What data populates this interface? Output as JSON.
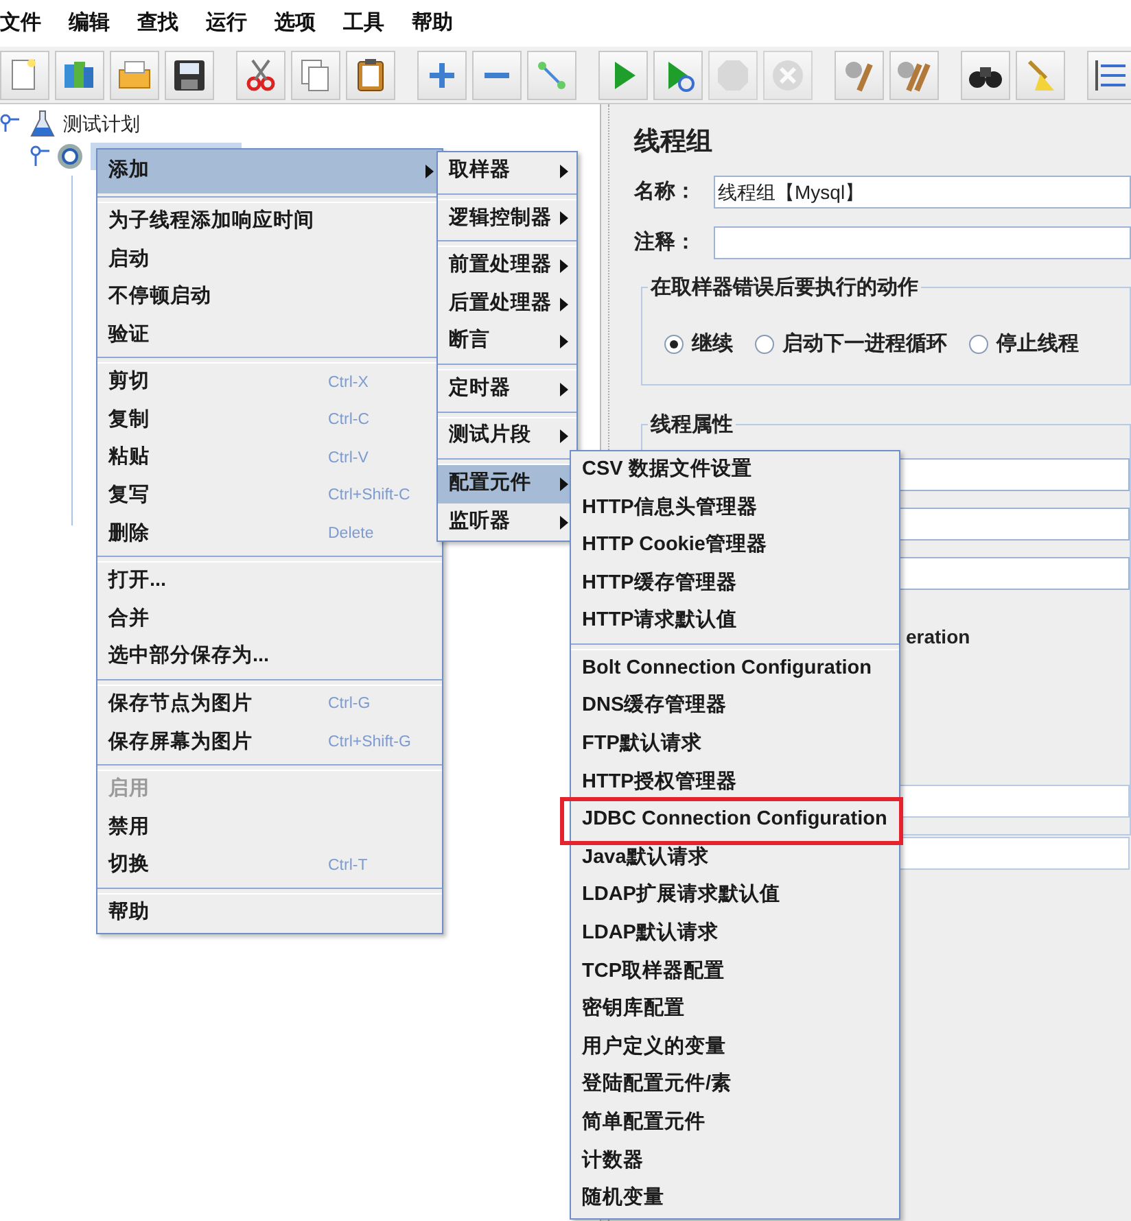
{
  "menu_bar": [
    "文件",
    "编辑",
    "查找",
    "运行",
    "选项",
    "工具",
    "帮助"
  ],
  "toolbar": [
    [
      {
        "disabled": false
      },
      {
        "disabled": false
      },
      {
        "disabled": false
      },
      {
        "disabled": false
      }
    ],
    [
      {
        "disabled": false
      },
      {
        "disabled": false
      },
      {
        "disabled": false
      }
    ],
    [
      {
        "disabled": false
      },
      {
        "disabled": false
      },
      {
        "disabled": false
      }
    ],
    [
      {
        "disabled": false
      },
      {
        "disabled": false
      },
      {
        "disabled": true
      },
      {
        "disabled": true
      }
    ],
    [
      {
        "disabled": false
      },
      {
        "disabled": false
      }
    ],
    [
      {
        "disabled": false
      },
      {
        "disabled": false
      }
    ],
    [
      {
        "disabled": false
      }
    ]
  ],
  "tree": {
    "label": "测试计划",
    "children": [
      {
        "selected": true
      }
    ]
  },
  "context_menu": [
    {
      "kind": "item",
      "label": "添加",
      "submenu": true,
      "selected": true
    },
    {
      "kind": "separator"
    },
    {
      "kind": "item",
      "label": "为子线程添加响应时间"
    },
    {
      "kind": "item",
      "label": "启动"
    },
    {
      "kind": "item",
      "label": "不停顿启动"
    },
    {
      "kind": "item",
      "label": "验证"
    },
    {
      "kind": "separator"
    },
    {
      "kind": "item",
      "label": "剪切",
      "shortcut": "Ctrl-X"
    },
    {
      "kind": "item",
      "label": "复制",
      "shortcut": "Ctrl-C"
    },
    {
      "kind": "item",
      "label": "粘贴",
      "shortcut": "Ctrl-V"
    },
    {
      "kind": "item",
      "label": "复写",
      "shortcut": "Ctrl+Shift-C"
    },
    {
      "kind": "item",
      "label": "删除",
      "shortcut": "Delete"
    },
    {
      "kind": "separator"
    },
    {
      "kind": "item",
      "label": "打开..."
    },
    {
      "kind": "item",
      "label": "合并"
    },
    {
      "kind": "item",
      "label": "选中部分保存为..."
    },
    {
      "kind": "separator"
    },
    {
      "kind": "item",
      "label": "保存节点为图片",
      "shortcut": "Ctrl-G"
    },
    {
      "kind": "item",
      "label": "保存屏幕为图片",
      "shortcut": "Ctrl+Shift-G"
    },
    {
      "kind": "separator"
    },
    {
      "kind": "item",
      "label": "启用",
      "disabled": true
    },
    {
      "kind": "item",
      "label": "禁用"
    },
    {
      "kind": "item",
      "label": "切换",
      "shortcut": "Ctrl-T"
    },
    {
      "kind": "separator"
    },
    {
      "kind": "item",
      "label": "帮助"
    }
  ],
  "add_submenu": [
    {
      "kind": "item",
      "label": "取样器",
      "submenu": true,
      "selected": false
    },
    {
      "kind": "separator"
    },
    {
      "kind": "item",
      "label": "逻辑控制器",
      "submenu": true,
      "selected": false
    },
    {
      "kind": "separator"
    },
    {
      "kind": "item",
      "label": "前置处理器",
      "submenu": true,
      "selected": false
    },
    {
      "kind": "item",
      "label": "后置处理器",
      "submenu": true,
      "selected": false
    },
    {
      "kind": "item",
      "label": "断言",
      "submenu": true,
      "selected": false
    },
    {
      "kind": "separator"
    },
    {
      "kind": "item",
      "label": "定时器",
      "submenu": true,
      "selected": false
    },
    {
      "kind": "separator"
    },
    {
      "kind": "item",
      "label": "测试片段",
      "submenu": true,
      "selected": false
    },
    {
      "kind": "separator"
    },
    {
      "kind": "item",
      "label": "配置元件",
      "submenu": true,
      "selected": true
    },
    {
      "kind": "item",
      "label": "监听器",
      "submenu": true,
      "selected": false
    }
  ],
  "config_submenu": [
    {
      "kind": "item",
      "label": "CSV 数据文件设置"
    },
    {
      "kind": "item",
      "label": "HTTP信息头管理器"
    },
    {
      "kind": "item",
      "label": "HTTP Cookie管理器"
    },
    {
      "kind": "item",
      "label": "HTTP缓存管理器"
    },
    {
      "kind": "item",
      "label": "HTTP请求默认值"
    },
    {
      "kind": "separator"
    },
    {
      "kind": "item",
      "label": "Bolt Connection Configuration"
    },
    {
      "kind": "item",
      "label": "DNS缓存管理器"
    },
    {
      "kind": "item",
      "label": "FTP默认请求"
    },
    {
      "kind": "item",
      "label": "HTTP授权管理器"
    },
    {
      "kind": "item",
      "label": "JDBC Connection Configuration",
      "highlighted": true
    },
    {
      "kind": "item",
      "label": "Java默认请求"
    },
    {
      "kind": "item",
      "label": "LDAP扩展请求默认值"
    },
    {
      "kind": "item",
      "label": "LDAP默认请求"
    },
    {
      "kind": "item",
      "label": "TCP取样器配置"
    },
    {
      "kind": "item",
      "label": "密钥库配置"
    },
    {
      "kind": "item",
      "label": "用户定义的变量"
    },
    {
      "kind": "item",
      "label": "登陆配置元件/素"
    },
    {
      "kind": "item",
      "label": "简单配置元件"
    },
    {
      "kind": "item",
      "label": "计数器"
    },
    {
      "kind": "item",
      "label": "随机变量"
    }
  ],
  "panel": {
    "title": "线程组",
    "name": {
      "label": "名称：",
      "value": "线程组【Mysql】"
    },
    "comment": {
      "label": "注释："
    },
    "on_error": {
      "legend": "在取样器错误后要执行的动作",
      "options": [
        {
          "label": "继续",
          "selected": true
        },
        {
          "label": "启动下一进程循环",
          "selected": false
        },
        {
          "label": "停止线程",
          "selected": false
        }
      ]
    },
    "thread_properties": {
      "legend": "线程属性",
      "partial_label": "eration"
    }
  }
}
